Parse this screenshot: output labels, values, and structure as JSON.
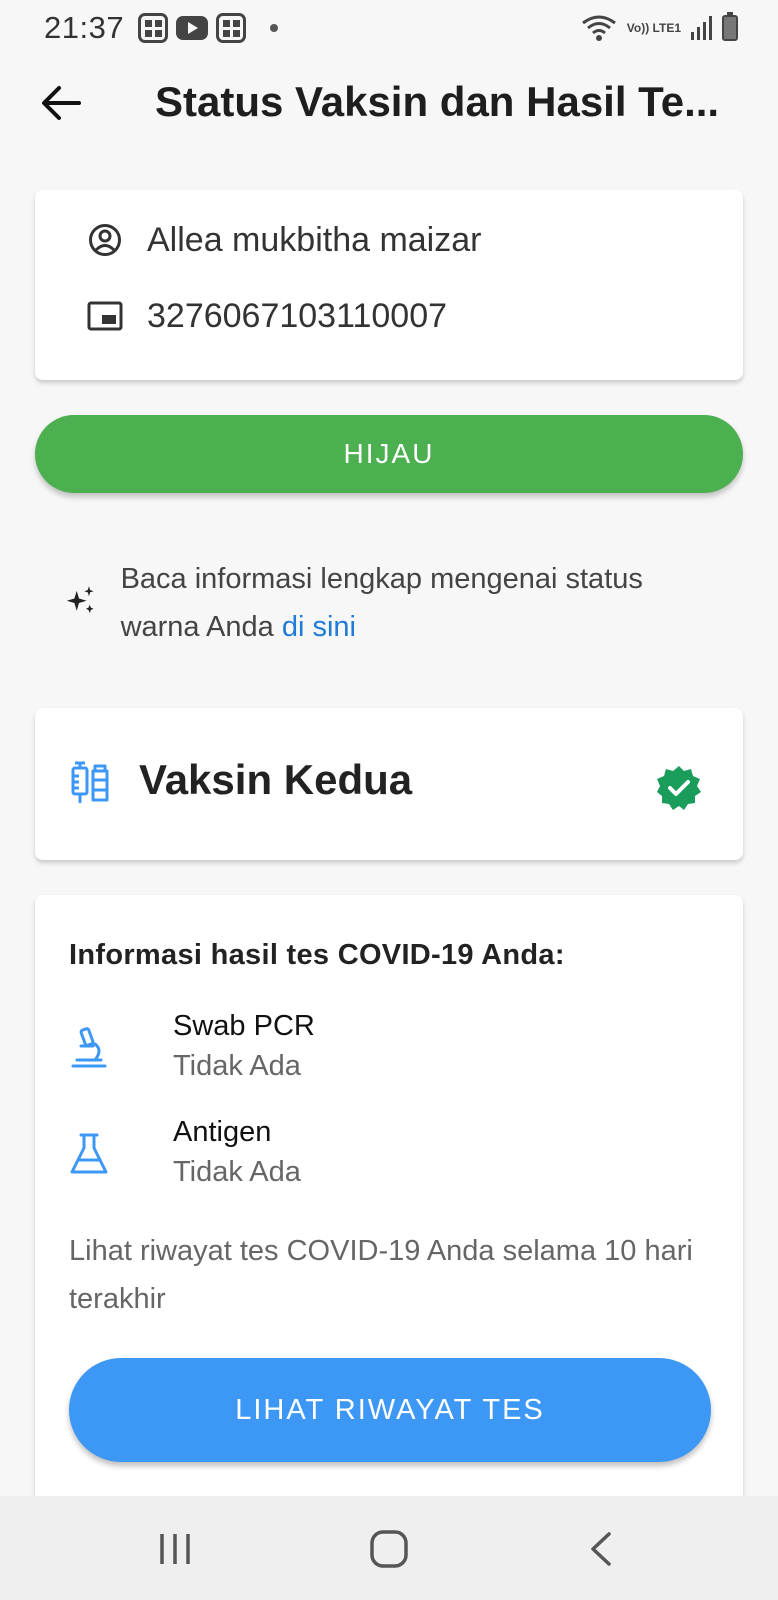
{
  "status_bar": {
    "time": "21:37",
    "network_label": "Vo)) LTE1"
  },
  "header": {
    "title": "Status Vaksin dan Hasil Te..."
  },
  "identity": {
    "name": "Allea mukbitha maizar",
    "nik": "3276067103110007"
  },
  "status": {
    "label": "HIJAU",
    "color": "#4caf50"
  },
  "info": {
    "text": "Baca informasi lengkap mengenai status warna Anda ",
    "link_text": "di sini",
    "link_color": "#1e7bd6"
  },
  "vaccine": {
    "title": "Vaksin Kedua",
    "verified_icon": "verified-check-icon",
    "badge_color": "#1a9c5a"
  },
  "covid_tests": {
    "heading": "Informasi hasil tes COVID-19 Anda:",
    "items": [
      {
        "name": "Swab PCR",
        "value": "Tidak Ada",
        "icon": "microscope-icon"
      },
      {
        "name": "Antigen",
        "value": "Tidak Ada",
        "icon": "flask-icon"
      }
    ],
    "history_text": "Lihat riwayat tes COVID-19 Anda selama 10 hari terakhir",
    "history_button": "LIHAT RIWAYAT TES",
    "accent_color": "#3d98f5"
  },
  "nav": {
    "items": [
      "recent-apps-icon",
      "home-icon",
      "back-icon"
    ]
  }
}
